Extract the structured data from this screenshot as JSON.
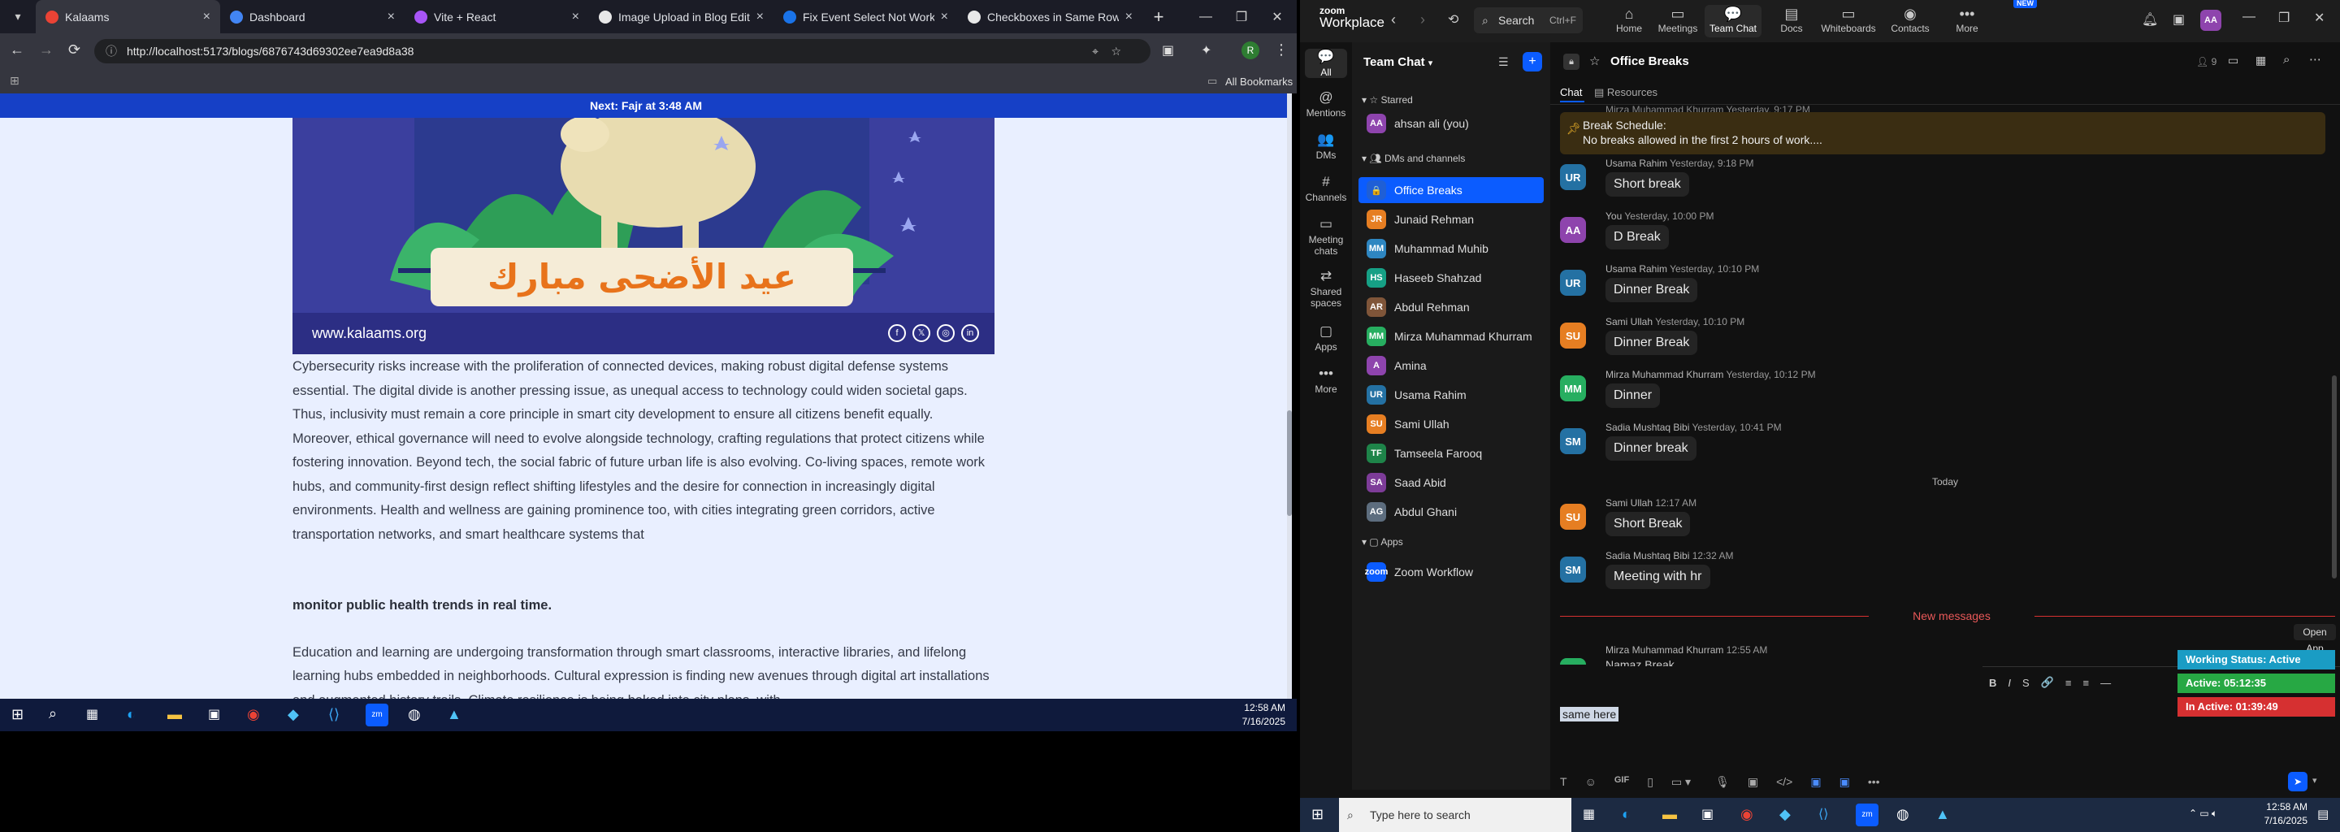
{
  "browser": {
    "tabs": [
      {
        "label": "Kalaams",
        "active": true,
        "color": "#ea4335"
      },
      {
        "label": "Dashboard",
        "active": false,
        "color": "#4285f4"
      },
      {
        "label": "Vite + React",
        "active": false,
        "color": "#a855f7"
      },
      {
        "label": "Image Upload in Blog Editor",
        "active": false,
        "color": "#e8e8e8"
      },
      {
        "label": "Fix Event Select Not Working",
        "active": false,
        "color": "#1a73e8"
      },
      {
        "label": "Checkboxes in Same Row",
        "active": false,
        "color": "#e8e8e8"
      }
    ],
    "new_tab": "+",
    "url": "http://localhost:5173/blogs/6876743d69302ee7ea9d8a38",
    "all_bookmarks": "All Bookmarks",
    "profile_initial": "R"
  },
  "blog": {
    "prayer_banner": "Next: Fajr at 3:48 AM",
    "banner_arabic": "عيد الأضحى مبارك",
    "banner_site": "www.kalaams.org",
    "paragraph1": "Cybersecurity risks increase with the proliferation of connected devices, making robust digital defense systems essential. The digital divide is another pressing issue, as unequal access to technology could widen societal gaps. Thus, inclusivity must remain a core principle in smart city development to ensure all citizens benefit equally. Moreover, ethical governance will need to evolve alongside technology, crafting regulations that protect citizens while fostering innovation. Beyond tech, the social fabric of future urban life is also evolving. Co-living spaces, remote work hubs, and community-first design reflect shifting lifestyles and the desire for connection in increasingly digital environments. Health and wellness are gaining prominence too, with cities integrating green corridors, active transportation networks, and smart healthcare systems that",
    "heading": "monitor public health trends in real time.",
    "paragraph2": "Education and learning are undergoing transformation through smart classrooms, interactive libraries, and lifelong learning hubs embedded in neighborhoods. Cultural expression is finding new avenues through digital art installations and augmented history trails. Climate resilience is being baked into city plans, with"
  },
  "taskbar_left": {
    "time": "12:58 AM",
    "date": "7/16/2025"
  },
  "zoom": {
    "logo_top": "zoom",
    "logo_bottom": "Workplace",
    "search_label": "Search",
    "search_shortcut": "Ctrl+F",
    "nav": [
      {
        "label": "Home",
        "icon": "home-icon",
        "glyph": "⌂"
      },
      {
        "label": "Meetings",
        "icon": "meetings-icon",
        "glyph": "▭"
      },
      {
        "label": "Team Chat",
        "icon": "team-chat-icon",
        "glyph": "💬"
      },
      {
        "label": "Docs",
        "icon": "docs-icon",
        "glyph": "▤"
      },
      {
        "label": "Whiteboards",
        "icon": "whiteboards-icon",
        "glyph": "▭"
      },
      {
        "label": "Contacts",
        "icon": "contacts-icon",
        "glyph": "◉"
      },
      {
        "label": "More",
        "icon": "more-icon",
        "glyph": "•••"
      }
    ],
    "new_badge": "NEW",
    "user_initials": "AA",
    "rail": [
      {
        "label": "All",
        "glyph": "💬"
      },
      {
        "label": "Mentions",
        "glyph": "@"
      },
      {
        "label": "DMs",
        "glyph": "👥"
      },
      {
        "label": "Channels",
        "glyph": "#"
      },
      {
        "label": "Meeting chats",
        "glyph": "▭"
      },
      {
        "label": "Shared spaces",
        "glyph": "⇄"
      },
      {
        "label": "Apps",
        "glyph": "▢"
      },
      {
        "label": "More",
        "glyph": "•••"
      }
    ],
    "sidebar_title": "Team Chat",
    "starred_label": "Starred",
    "starred": [
      {
        "name": "ahsan ali (you)",
        "initials": "AA",
        "color": "#8e44ad"
      }
    ],
    "dms_label": "DMs and channels",
    "channels": [
      {
        "name": "Office Breaks",
        "initials": "🔒",
        "color": "#1f5fd6",
        "selected": true
      },
      {
        "name": "Junaid Rehman",
        "initials": "JR",
        "color": "#e67e22"
      },
      {
        "name": "Muhammad Muhib",
        "initials": "MM",
        "color": "#2e86c1"
      },
      {
        "name": "Haseeb Shahzad",
        "initials": "HS",
        "color": "#16a085"
      },
      {
        "name": "Abdul Rehman",
        "initials": "AR",
        "color": "#7f5539"
      },
      {
        "name": "Mirza Muhammad Khurram",
        "initials": "MM",
        "color": "#27ae60"
      },
      {
        "name": "Amina",
        "initials": "A",
        "color": "#8e44ad"
      },
      {
        "name": "Usama Rahim",
        "initials": "UR",
        "color": "#2471a3"
      },
      {
        "name": "Sami Ullah",
        "initials": "SU",
        "color": "#e67e22"
      },
      {
        "name": "Tamseela Farooq",
        "initials": "TF",
        "color": "#1e8449"
      },
      {
        "name": "Saad Abid",
        "initials": "SA",
        "color": "#7d3c98"
      },
      {
        "name": "Abdul Ghani",
        "initials": "AG",
        "color": "#5d6d7e"
      }
    ],
    "apps_label": "Apps",
    "apps": [
      {
        "name": "Zoom Workflow",
        "initials": "zoom",
        "color": "#0b5cff"
      }
    ],
    "channel_title": "Office Breaks",
    "member_count": "9",
    "tabs": [
      {
        "label": "Chat"
      },
      {
        "label": "Resources"
      }
    ],
    "pinned_title": "Break Schedule:",
    "pinned_text": "No breaks allowed in the first 2 hours of work....",
    "pinned_partial_meta": "Mirza Muhammad Khurram Yesterday, 9:17 PM",
    "messages": [
      {
        "initials": "UR",
        "color": "#2471a3",
        "name": "Usama Rahim",
        "time": "Yesterday, 9:18 PM",
        "text": "Short break"
      },
      {
        "initials": "AA",
        "color": "#8e44ad",
        "name": "You",
        "time": "Yesterday, 10:00 PM",
        "text": "D Break"
      },
      {
        "initials": "UR",
        "color": "#2471a3",
        "name": "Usama Rahim",
        "time": "Yesterday, 10:10 PM",
        "text": "Dinner Break"
      },
      {
        "initials": "SU",
        "color": "#e67e22",
        "name": "Sami Ullah",
        "time": "Yesterday, 10:10 PM",
        "text": "Dinner Break"
      },
      {
        "initials": "MM",
        "color": "#27ae60",
        "name": "Mirza Muhammad Khurram",
        "time": "Yesterday, 10:12 PM",
        "text": "Dinner"
      },
      {
        "initials": "SM",
        "color": "#2471a3",
        "name": "Sadia Mushtaq Bibi",
        "time": "Yesterday, 10:41 PM",
        "text": "Dinner break"
      },
      {
        "initials": "SU",
        "color": "#e67e22",
        "name": "Sami Ullah",
        "time": "12:17 AM",
        "text": "Short Break"
      },
      {
        "initials": "SM",
        "color": "#2471a3",
        "name": "Sadia Mushtaq Bibi",
        "time": "12:32 AM",
        "text": "Meeting with hr"
      }
    ],
    "today_label": "Today",
    "new_messages_label": "New messages",
    "last_meta_name": "Mirza Muhammad Khurram",
    "last_meta_time": "12:55 AM",
    "last_partial": "Namaz Break",
    "open_app": "Open App",
    "status": [
      {
        "text": "Working Status: Active",
        "color": "#1a9cc4"
      },
      {
        "text": "Active: 05:12:35",
        "color": "#27a844"
      },
      {
        "text": "In Active: 01:39:49",
        "color": "#d63031"
      }
    ],
    "compose_text": "same here",
    "format_tools": [
      "B",
      "I",
      "S",
      "🔗",
      "≡",
      "≡",
      "—"
    ],
    "send_icon": "➤"
  },
  "win_taskbar": {
    "search_placeholder": "Type here to search",
    "time": "12:58 AM",
    "date": "7/16/2025"
  }
}
